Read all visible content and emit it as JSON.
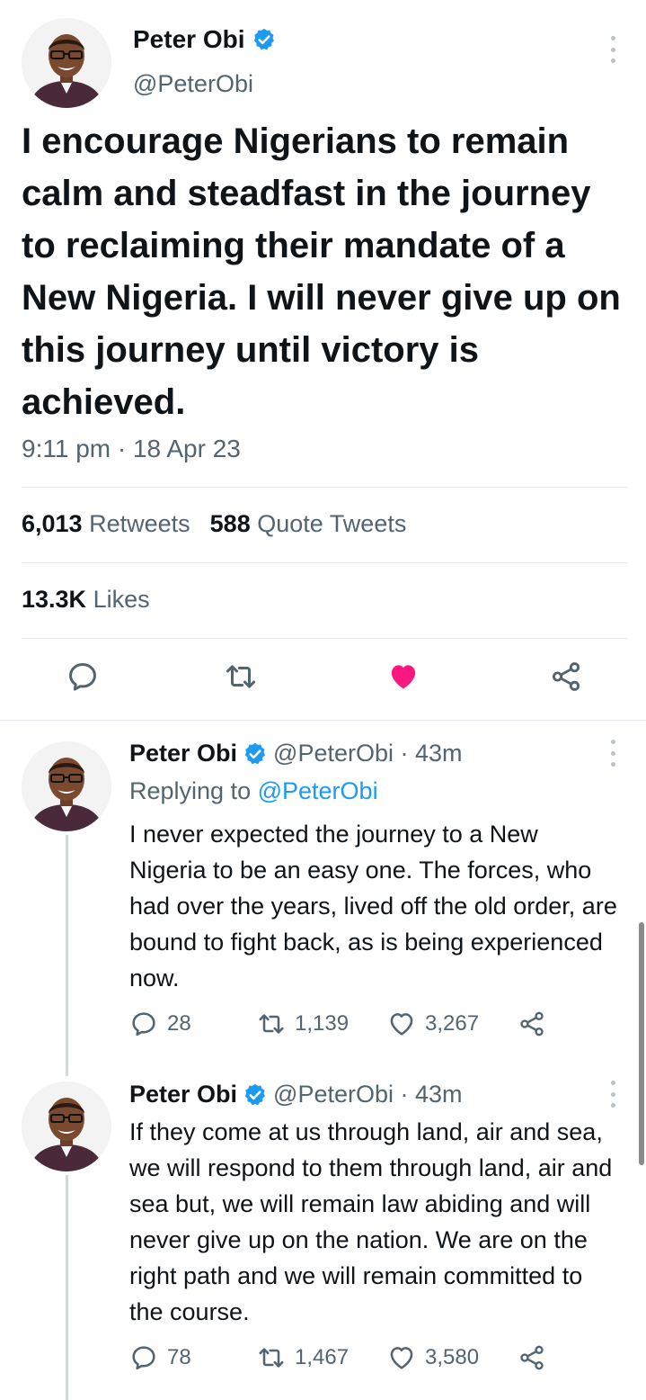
{
  "colors": {
    "accent": "#1d9bf0",
    "like": "#f91880",
    "muted": "#536471",
    "text": "#0f1419"
  },
  "main_tweet": {
    "author_name": "Peter Obi",
    "author_handle": "@PeterObi",
    "text": "I encourage Nigerians to remain calm and steadfast in the journey to reclaiming their mandate of a New Nigeria. I will never give up on this journey until victory is achieved.",
    "timestamp": "9:11 pm · 18 Apr 23",
    "retweets_count": "6,013",
    "retweets_label": "Retweets",
    "quote_tweets_count": "588",
    "quote_tweets_label": "Quote Tweets",
    "likes_count": "13.3K",
    "likes_label": "Likes",
    "liked": true,
    "icons": [
      "reply-icon",
      "retweet-icon",
      "heart-icon",
      "share-icon"
    ]
  },
  "replies": [
    {
      "author_name": "Peter Obi",
      "meta": "@PeterObi · 43m",
      "replying_prefix": "Replying to",
      "replying_to": "@PeterObi",
      "text": "I never expected the journey to a New Nigeria to be an easy one. The forces, who had over the years, lived off the old order, are bound to fight back, as is being experienced now.",
      "reply_count": "28",
      "retweet_count": "1,139",
      "like_count": "3,267"
    },
    {
      "author_name": "Peter Obi",
      "meta": "@PeterObi · 43m",
      "text": "If they come at us through land, air and sea, we will respond to them through land, air and sea but, we will remain law abiding and will never give up on the nation. We are on the right path and we will remain committed to the course.",
      "reply_count": "78",
      "retweet_count": "1,467",
      "like_count": "3,580"
    }
  ]
}
